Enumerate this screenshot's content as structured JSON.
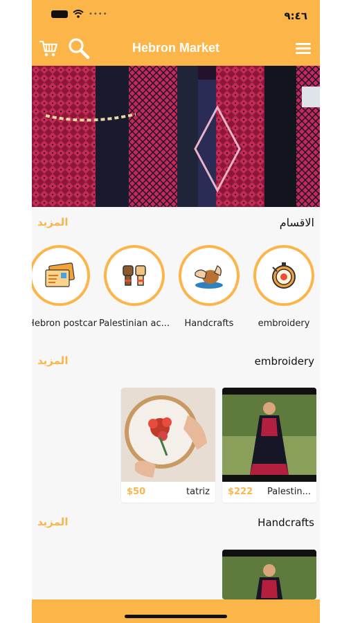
{
  "status_bar": {
    "time": "٩:٤٦"
  },
  "header": {
    "title": "Hebron Market",
    "cart_icon": "cart-icon",
    "search_icon": "search-icon",
    "menu_icon": "hamburger-menu-icon"
  },
  "categories_section": {
    "title": "الاقسام",
    "more": "المزيد",
    "items": [
      {
        "label": "embroidery",
        "icon": "embroidery-hoop-icon"
      },
      {
        "label": "Handcrafts",
        "icon": "pottery-hands-icon"
      },
      {
        "label": "Palestinian ac...",
        "icon": "raised-fists-icon"
      },
      {
        "label": "Hebron postcar",
        "icon": "postcards-icon"
      }
    ]
  },
  "embroidery_section": {
    "title": "embroidery",
    "more": "المزيد",
    "products": [
      {
        "name": "Palestin...",
        "price": "$222"
      },
      {
        "name": "tatriz",
        "price": "$50"
      }
    ]
  },
  "handcrafts_section": {
    "title": "Handcrafts",
    "more": "المزيد"
  },
  "colors": {
    "accent": "#fbb549",
    "background": "#f7f7f7"
  }
}
